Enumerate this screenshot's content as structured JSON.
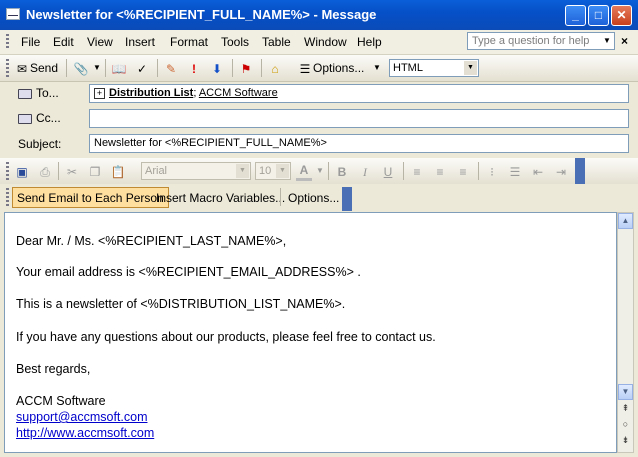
{
  "window": {
    "title": "Newsletter for <%RECIPIENT_FULL_NAME%> - Message",
    "minimize": "_",
    "maximize": "□",
    "close": "✕"
  },
  "menubar": {
    "items": [
      {
        "label": "File"
      },
      {
        "label": "Edit"
      },
      {
        "label": "View"
      },
      {
        "label": "Insert"
      },
      {
        "label": "Format"
      },
      {
        "label": "Tools"
      },
      {
        "label": "Table"
      },
      {
        "label": "Window"
      },
      {
        "label": "Help"
      }
    ],
    "help_placeholder": "Type a question for help"
  },
  "toolbar": {
    "send_label": "Send",
    "options_label": "Options...",
    "format_value": "HTML"
  },
  "headers": {
    "to_label": "To...",
    "cc_label": "Cc...",
    "subject_label": "Subject:",
    "to_value_list": "Distribution List",
    "to_sep": ";",
    "to_value_company": "ACCM Software",
    "cc_value": "",
    "subject_value": "Newsletter for <%RECIPIENT_FULL_NAME%>"
  },
  "format_toolbar": {
    "font_value": "Arial",
    "size_value": "10"
  },
  "macro_bar": {
    "send_each": "Send Email to Each Person",
    "insert_macro": "Insert Macro Variables...",
    "options": "Options..."
  },
  "body": {
    "greeting": "Dear Mr. / Ms. <%RECIPIENT_LAST_NAME%>,",
    "email_line": "Your email address is <%RECIPIENT_EMAIL_ADDRESS%> .",
    "newsletter_line": "This is a newsletter of <%DISTRIBUTION_LIST_NAME%>.",
    "questions_line": "If you have any questions about our products, please feel free to contact us.",
    "regards": "Best regards,",
    "signature_name": "ACCM Software",
    "support_email": "support@accmsoft.com",
    "website": "http://www.accmsoft.com"
  }
}
